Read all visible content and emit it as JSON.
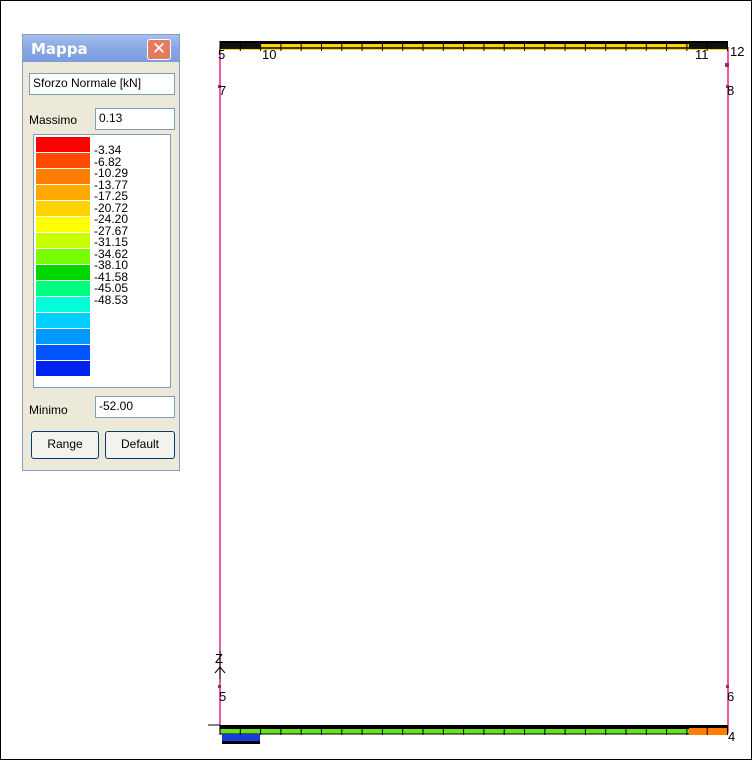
{
  "palette": {
    "title": "Mappa",
    "quantity": "Sforzo Normale [kN]",
    "max_label": "Massimo",
    "max_value": "0.13",
    "min_label": "Minimo",
    "min_value": "-52.00",
    "range_button": "Range",
    "default_button": "Default",
    "legend": [
      {
        "value": "-3.34",
        "color": "#ff0000"
      },
      {
        "value": "-6.82",
        "color": "#ff4a00"
      },
      {
        "value": "-10.29",
        "color": "#ff7d00"
      },
      {
        "value": "-13.77",
        "color": "#ffa800"
      },
      {
        "value": "-17.25",
        "color": "#ffd200"
      },
      {
        "value": "-20.72",
        "color": "#ffff00"
      },
      {
        "value": "-24.20",
        "color": "#c8ff00"
      },
      {
        "value": "-27.67",
        "color": "#78ff00"
      },
      {
        "value": "-31.15",
        "color": "#00d600"
      },
      {
        "value": "-34.62",
        "color": "#00ff7c"
      },
      {
        "value": "-38.10",
        "color": "#00ffd8"
      },
      {
        "value": "-41.58",
        "color": "#00d0ff"
      },
      {
        "value": "-45.05",
        "color": "#0099ff"
      },
      {
        "value": "-48.53",
        "color": "#0055ff"
      },
      {
        "value": "",
        "color": "#0022ee"
      }
    ]
  },
  "model": {
    "frame_color": "#e0007a",
    "top_beam_color": "#ffd700",
    "bottom_beam_color": "#66e022",
    "node_labels": {
      "n5": "5",
      "n6": "6",
      "n7": "7",
      "n8": "8",
      "n10": "10",
      "n11": "11",
      "n12": "12",
      "n4": "4",
      "axis": "Z"
    }
  }
}
